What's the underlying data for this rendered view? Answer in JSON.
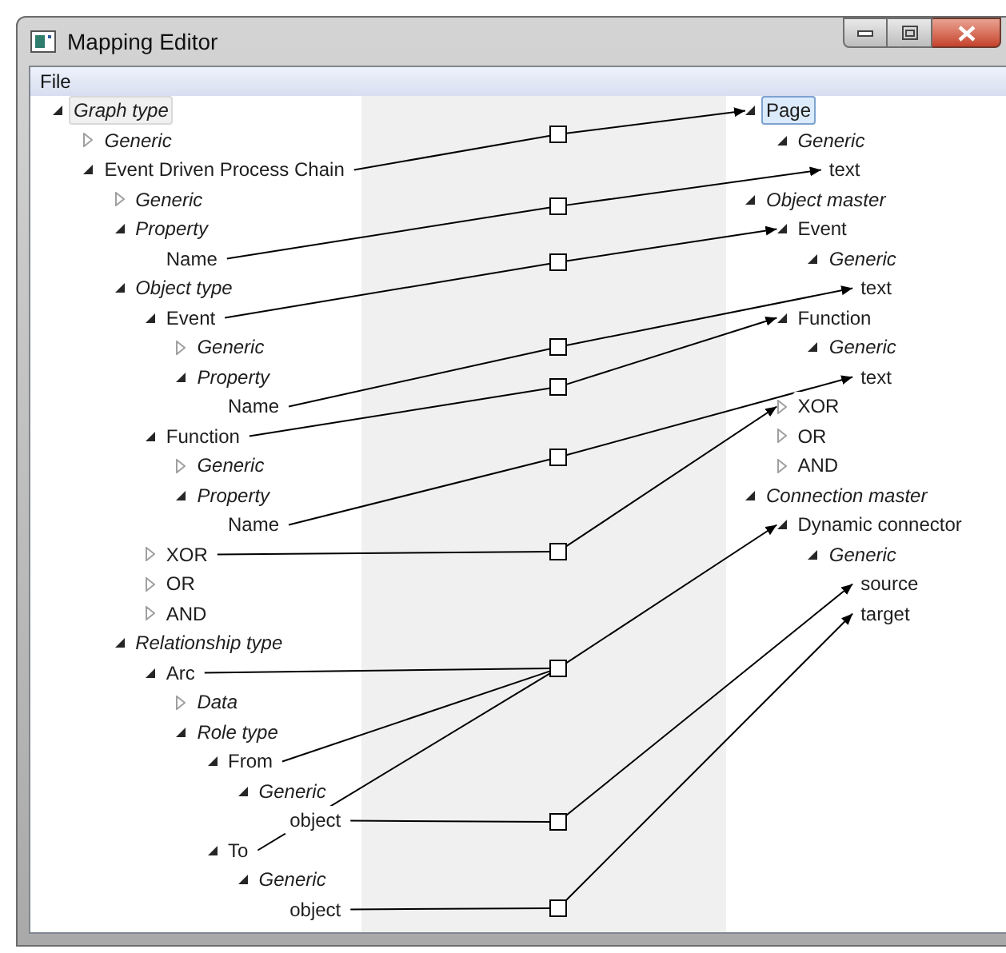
{
  "window": {
    "title": "Mapping Editor"
  },
  "menu": [
    "File"
  ],
  "left_tree": {
    "focused": false,
    "items": [
      {
        "label": "Graph type",
        "kind": "category",
        "expanded": true,
        "selected": true,
        "children": [
          {
            "label": "Generic",
            "kind": "category",
            "expanded": false,
            "selected": false
          },
          {
            "label": "Event Driven Process Chain",
            "kind": "element",
            "expanded": true,
            "selected": false,
            "children": [
              {
                "label": "Generic",
                "kind": "category",
                "expanded": false,
                "selected": false
              },
              {
                "label": "Property",
                "kind": "category",
                "expanded": true,
                "selected": false,
                "children": [
                  {
                    "label": "Name",
                    "kind": "element",
                    "selected": false
                  }
                ]
              },
              {
                "label": "Object type",
                "kind": "category",
                "expanded": true,
                "selected": false,
                "children": [
                  {
                    "label": "Event",
                    "kind": "element",
                    "expanded": true,
                    "selected": false,
                    "children": [
                      {
                        "label": "Generic",
                        "kind": "category",
                        "expanded": false,
                        "selected": false
                      },
                      {
                        "label": "Property",
                        "kind": "category",
                        "expanded": true,
                        "selected": false,
                        "children": [
                          {
                            "label": "Name",
                            "kind": "element",
                            "selected": false
                          }
                        ]
                      }
                    ]
                  },
                  {
                    "label": "Function",
                    "kind": "element",
                    "expanded": true,
                    "selected": false,
                    "children": [
                      {
                        "label": "Generic",
                        "kind": "category",
                        "expanded": false,
                        "selected": false
                      },
                      {
                        "label": "Property",
                        "kind": "category",
                        "expanded": true,
                        "selected": false,
                        "children": [
                          {
                            "label": "Name",
                            "kind": "element",
                            "selected": false
                          }
                        ]
                      }
                    ]
                  },
                  {
                    "label": "XOR",
                    "kind": "element",
                    "expanded": false,
                    "selected": false
                  },
                  {
                    "label": "OR",
                    "kind": "element",
                    "expanded": false,
                    "selected": false
                  },
                  {
                    "label": "AND",
                    "kind": "element",
                    "expanded": false,
                    "selected": false
                  }
                ]
              },
              {
                "label": "Relationship type",
                "kind": "category",
                "expanded": true,
                "selected": false,
                "children": [
                  {
                    "label": "Arc",
                    "kind": "element",
                    "expanded": true,
                    "selected": false,
                    "children": [
                      {
                        "label": "Data",
                        "kind": "category",
                        "expanded": false,
                        "selected": false
                      },
                      {
                        "label": "Role type",
                        "kind": "category",
                        "expanded": true,
                        "selected": false,
                        "children": [
                          {
                            "label": "From",
                            "kind": "element",
                            "expanded": true,
                            "selected": false,
                            "children": [
                              {
                                "label": "Generic",
                                "kind": "category",
                                "expanded": true,
                                "selected": false,
                                "children": [
                                  {
                                    "label": "object",
                                    "kind": "element",
                                    "selected": false
                                  }
                                ]
                              }
                            ]
                          },
                          {
                            "label": "To",
                            "kind": "element",
                            "expanded": true,
                            "selected": false,
                            "children": [
                              {
                                "label": "Generic",
                                "kind": "category",
                                "expanded": true,
                                "selected": false,
                                "children": [
                                  {
                                    "label": "object",
                                    "kind": "element",
                                    "selected": false
                                  }
                                ]
                              }
                            ]
                          }
                        ]
                      }
                    ]
                  }
                ]
              }
            ]
          }
        ]
      }
    ]
  },
  "right_tree": {
    "focused": true,
    "items": [
      {
        "label": "Page",
        "kind": "element",
        "expanded": true,
        "selected": true,
        "children": [
          {
            "label": "Generic",
            "kind": "category",
            "expanded": true,
            "selected": false,
            "children": [
              {
                "label": "text",
                "kind": "element",
                "selected": false
              }
            ]
          }
        ]
      },
      {
        "label": "Object master",
        "kind": "category",
        "expanded": true,
        "selected": false,
        "children": [
          {
            "label": "Event",
            "kind": "element",
            "expanded": true,
            "selected": false,
            "children": [
              {
                "label": "Generic",
                "kind": "category",
                "expanded": true,
                "selected": false,
                "children": [
                  {
                    "label": "text",
                    "kind": "element",
                    "selected": false
                  }
                ]
              }
            ]
          },
          {
            "label": "Function",
            "kind": "element",
            "expanded": true,
            "selected": false,
            "children": [
              {
                "label": "Generic",
                "kind": "category",
                "expanded": true,
                "selected": false,
                "children": [
                  {
                    "label": "text",
                    "kind": "element",
                    "selected": false
                  }
                ]
              }
            ]
          },
          {
            "label": "XOR",
            "kind": "element",
            "expanded": false,
            "selected": false
          },
          {
            "label": "OR",
            "kind": "element",
            "expanded": false,
            "selected": false
          },
          {
            "label": "AND",
            "kind": "element",
            "expanded": false,
            "selected": false
          }
        ]
      },
      {
        "label": "Connection master",
        "kind": "category",
        "expanded": true,
        "selected": false,
        "children": [
          {
            "label": "Dynamic connector",
            "kind": "element",
            "expanded": true,
            "selected": false,
            "children": [
              {
                "label": "Generic",
                "kind": "category",
                "expanded": true,
                "selected": false,
                "children": [
                  {
                    "label": "source",
                    "kind": "element",
                    "selected": false
                  },
                  {
                    "label": "target",
                    "kind": "element",
                    "selected": false
                  }
                ]
              }
            ]
          }
        ]
      }
    ]
  }
}
